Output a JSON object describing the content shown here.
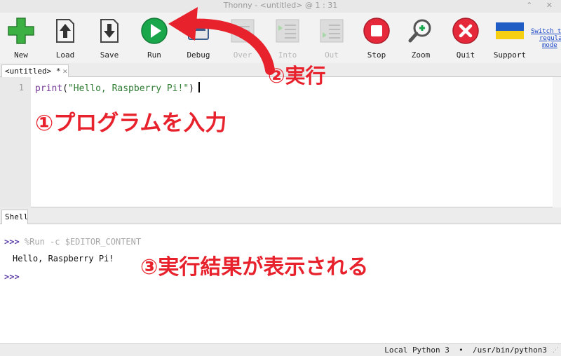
{
  "window": {
    "title": "Thonny  -  <untitled>  @  1 : 31",
    "controls": "⌃ ✕"
  },
  "toolbar": {
    "buttons": [
      {
        "label": "New",
        "icon": "new-file-icon"
      },
      {
        "label": "Load",
        "icon": "load-icon"
      },
      {
        "label": "Save",
        "icon": "save-icon"
      },
      {
        "label": "Run",
        "icon": "run-icon"
      },
      {
        "label": "Debug",
        "icon": "debug-icon"
      },
      {
        "label": "Over",
        "icon": "step-over-icon"
      },
      {
        "label": "Into",
        "icon": "step-into-icon"
      },
      {
        "label": "Out",
        "icon": "step-out-icon"
      },
      {
        "label": "Stop",
        "icon": "stop-icon"
      },
      {
        "label": "Zoom",
        "icon": "zoom-icon"
      },
      {
        "label": "Quit",
        "icon": "quit-icon"
      },
      {
        "label": "Support",
        "icon": "ukraine-flag-icon"
      }
    ],
    "switch_mode_line1": "Switch to",
    "switch_mode_line2": "regular",
    "switch_mode_line3": "mode"
  },
  "editor": {
    "tab_label": "<untitled> *",
    "tab_close": "✕",
    "line_number": "1",
    "code_fn": "print",
    "code_open": "(",
    "code_string": "\"Hello, Raspberry Pi!\"",
    "code_close": ")"
  },
  "shell": {
    "tab_label": "Shell",
    "prompt": ">>>",
    "command": "%Run -c $EDITOR_CONTENT",
    "output": "Hello, Raspberry Pi!"
  },
  "statusbar": {
    "text": "Local Python 3  •  /usr/bin/python3"
  },
  "annotations": {
    "step1": "①プログラムを入力",
    "step2": "②実行",
    "step3": "③実行結果が表示される",
    "color": "#e8222d"
  },
  "colors": {
    "run_green": "#1aa64a",
    "stop_red": "#e5283a",
    "prompt_purple": "#5b3da8",
    "string_green": "#2e7d32",
    "link_blue": "#1a47c9"
  }
}
